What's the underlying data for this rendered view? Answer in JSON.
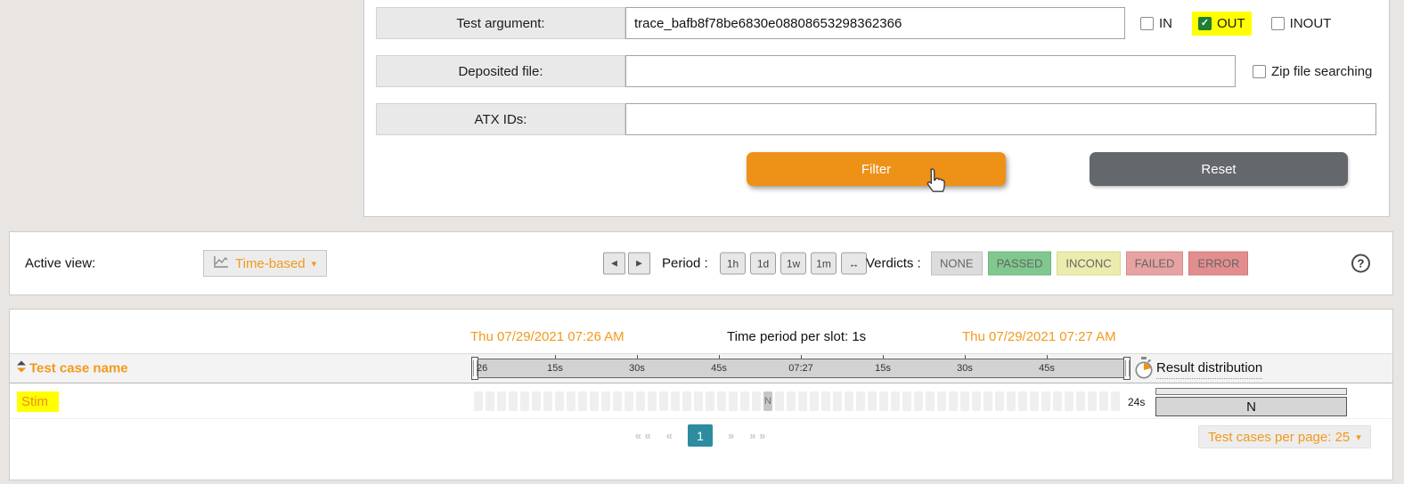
{
  "colors": {
    "accent_orange": "#f2991c",
    "filter_button_orange": "#ee9117",
    "reset_gray": "#64676b",
    "pagination_teal": "#2d8c9f",
    "highlight_yellow": "#ffff00",
    "checkbox_green": "#1f7d36"
  },
  "filter_panel": {
    "rows": [
      {
        "label": "Test argument:",
        "value": "trace_bafb8f78be6830e08808653298362366"
      },
      {
        "label": "Deposited file:",
        "value": ""
      },
      {
        "label": "ATX IDs:",
        "value": ""
      }
    ],
    "direction_checkboxes": [
      {
        "label": "IN",
        "checked": false,
        "highlighted": false
      },
      {
        "label": "OUT",
        "checked": true,
        "highlighted": true
      },
      {
        "label": "INOUT",
        "checked": false,
        "highlighted": false
      }
    ],
    "zip_checkbox": {
      "label": "Zip file searching",
      "checked": false
    },
    "filter_button": "Filter",
    "reset_button": "Reset"
  },
  "view_bar": {
    "label": "Active view:",
    "selector": {
      "label": "Time-based",
      "caret": "▾"
    },
    "nav_back": "◀",
    "nav_forward": "▶",
    "period_label": "Period :",
    "periods": [
      "1h",
      "1d",
      "1w",
      "1m",
      "↔"
    ],
    "verdicts_label": "Verdicts :",
    "verdicts": [
      {
        "label": "NONE",
        "bg": "#dcdcdc",
        "border": "#bfbfbf"
      },
      {
        "label": "PASSED",
        "bg": "#80c88d",
        "border": "#6cb57a"
      },
      {
        "label": "INCONC",
        "bg": "#ebecad",
        "border": "#d8d98e"
      },
      {
        "label": "FAILED",
        "bg": "#e7a2a2",
        "border": "#d68b8b"
      },
      {
        "label": "ERROR",
        "bg": "#e38e8e",
        "border": "#d07575"
      }
    ],
    "help": "?"
  },
  "timeline_table": {
    "start_time": "Thu 07/29/2021 07:26 AM",
    "slot_info": "Time period per slot: 1s",
    "end_time": "Thu 07/29/2021 07:27 AM",
    "name_header": "Test case name",
    "result_header": "Result distribution",
    "ticks": [
      "26",
      "15s",
      "30s",
      "45s",
      "07:27",
      "15s",
      "30s",
      "45s"
    ],
    "row": {
      "name": "Stim",
      "slots": {
        "count": 56,
        "n_index": 25,
        "n_label": "N"
      },
      "duration": "24s",
      "result": "N"
    },
    "pagination": {
      "items": [
        "« «",
        "«",
        "1",
        "»",
        "» »"
      ],
      "active": "1"
    },
    "per_page": {
      "label": "Test cases per page: 25",
      "caret": "▾"
    }
  }
}
